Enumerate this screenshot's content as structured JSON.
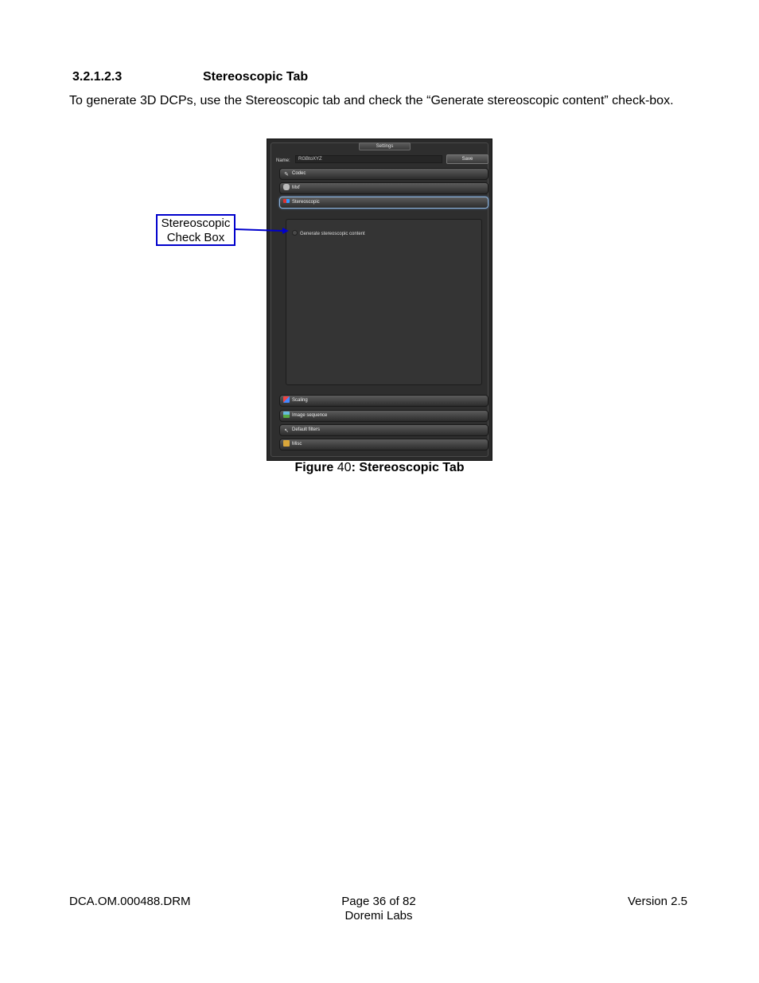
{
  "section": {
    "number": "3.2.1.2.3",
    "title": "Stereoscopic Tab"
  },
  "intro_text": "To generate 3D DCPs, use the Stereoscopic tab and check the “Generate stereoscopic content” check-box.",
  "settings_panel": {
    "title": "Settings",
    "name_label": "Name:",
    "name_value": "RGBtoXYZ",
    "save_label": "Save",
    "tabs_top": [
      {
        "label": "Codec",
        "icon": "wrench-icon"
      },
      {
        "label": "Mxf",
        "icon": "database-icon"
      },
      {
        "label": "Stereoscopic",
        "icon": "glasses-icon"
      }
    ],
    "checkbox_label": "Generate stereoscopic content",
    "checkbox_checked": false,
    "tabs_bottom": [
      {
        "label": "Scaling",
        "icon": "scale-icon"
      },
      {
        "label": "Image sequence",
        "icon": "image-icon"
      },
      {
        "label": "Default filters",
        "icon": "brush-icon"
      },
      {
        "label": "Misc",
        "icon": "folder-icon"
      }
    ]
  },
  "callout": {
    "line1": "Stereoscopic",
    "line2": "Check Box"
  },
  "caption": {
    "prefix": "Figure",
    "number": "40",
    "separator": ":",
    "title": "Stereoscopic Tab"
  },
  "footer": {
    "doc_id": "DCA.OM.000488.DRM",
    "page": "Page 36 of 82",
    "company": "Doremi Labs",
    "version": "Version 2.5"
  }
}
